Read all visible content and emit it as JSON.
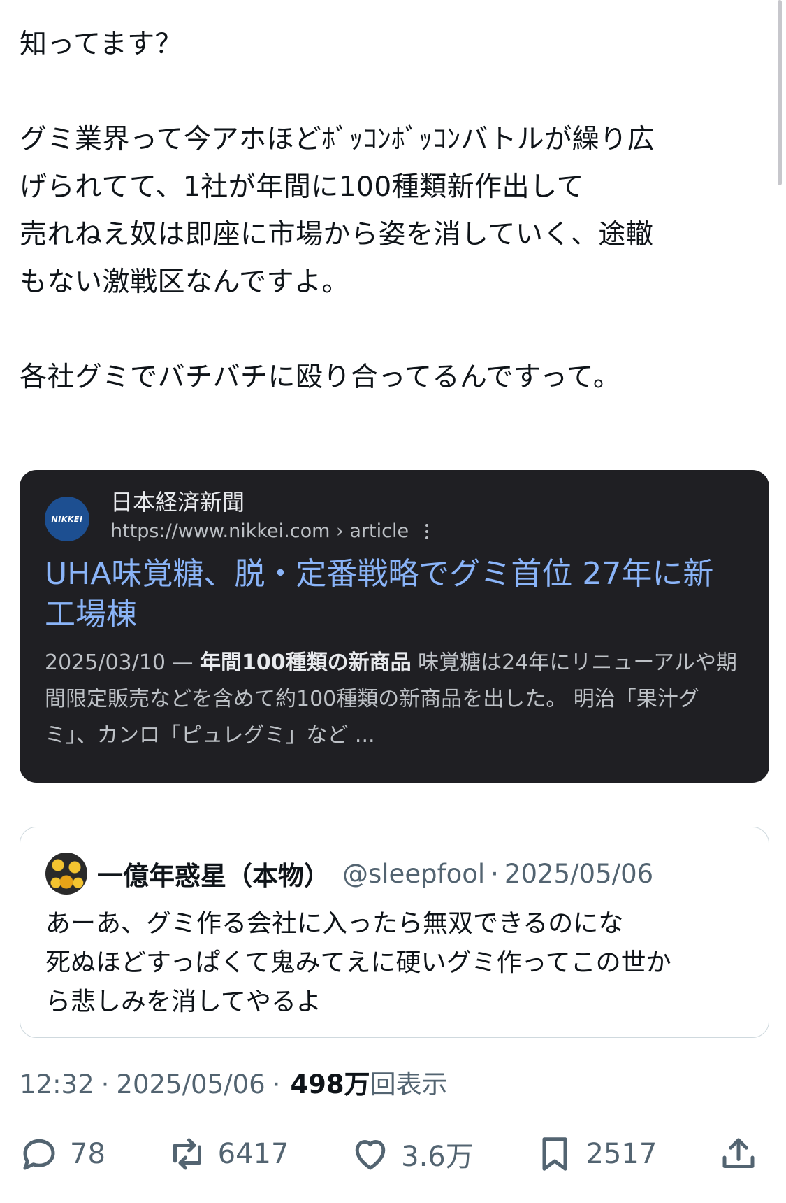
{
  "tweet": {
    "line_1": "知ってます？",
    "line_2": "グミ業界って今アホほどﾎﾞｯｺﾝﾎﾞｯｺﾝバトルが繰り広",
    "line_3": "げられてて、1社が年間に100種類新作出して",
    "line_4": "売れねえ奴は即座に市場から姿を消していく、途轍",
    "line_5": "もない激戦区なんですよ。",
    "line_6": "各社グミでバチバチに殴り合ってるんですって。"
  },
  "link_card": {
    "logo_text": "NIKKEI",
    "site_name": "日本経済新聞",
    "site_url": "https://www.nikkei.com › article",
    "title": "UHA味覚糖、脱・定番戦略でグミ首位 27年に新工場棟",
    "snippet_date": "2025/03/10 — ",
    "snippet_bold": "年間100種類の新商品",
    "snippet_rest": " 味覚糖は24年にリニューアルや期間限定販売などを含めて約100種類の新商品を出した。 明治「果汁グミ」、カンロ「ピュレグミ」など ..."
  },
  "quote": {
    "name": "一億年惑星（本物）",
    "handle": "@sleepfool",
    "dot": "·",
    "date": "2025/05/06",
    "line_1": "あーあ、グミ作る会社に入ったら無双できるのにな",
    "line_2": "死ぬほどすっぱくて鬼みてえに硬いグミ作ってこの世か",
    "line_3": "ら悲しみを消してやるよ"
  },
  "meta": {
    "time": "12:32",
    "sep1": "·",
    "date": "2025/05/06",
    "sep2": "·",
    "views_count": "498万",
    "views_label": "回表示"
  },
  "actions": {
    "reply_icon": "reply-bubble-icon",
    "reply_count": "78",
    "retweet_icon": "retweet-icon",
    "retweet_count": "6417",
    "like_icon": "heart-icon",
    "like_count": "3.6万",
    "bookmark_icon": "bookmark-icon",
    "bookmark_count": "2517",
    "share_icon": "share-upload-icon"
  },
  "colors": {
    "text": "#0f1419",
    "secondary": "#536471",
    "card_bg": "#1f1f23",
    "card_link": "#8ab4f8"
  }
}
